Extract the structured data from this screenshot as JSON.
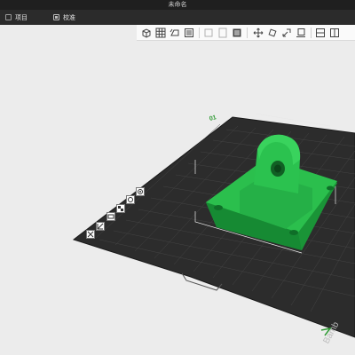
{
  "window": {
    "title": "未命名"
  },
  "tabs": [
    {
      "label": "项目"
    },
    {
      "label": "校准"
    }
  ],
  "bed": {
    "number_label": "01",
    "brand_text": "Bamb"
  },
  "toolbar": {
    "icons": [
      "add-cube-icon",
      "grid-view-icon",
      "auto-orient-icon",
      "layer-view-icon",
      "copy-icon",
      "paste-icon",
      "list-icon",
      "move-icon",
      "rotate-icon",
      "scale-icon",
      "lay-flat-icon",
      "split-icon",
      "cut-icon"
    ]
  },
  "side_tools": {
    "icons": [
      "close-view-icon",
      "perspective-icon",
      "plate-edit-icon",
      "arrange-icon",
      "orient-icon",
      "settings-icon"
    ]
  },
  "colors": {
    "model": "#20b043",
    "bed": "#2c2c2c",
    "accent": "#2f9a34",
    "titlebar": "#1f1f1f",
    "tabbar": "#2b2b2b"
  }
}
